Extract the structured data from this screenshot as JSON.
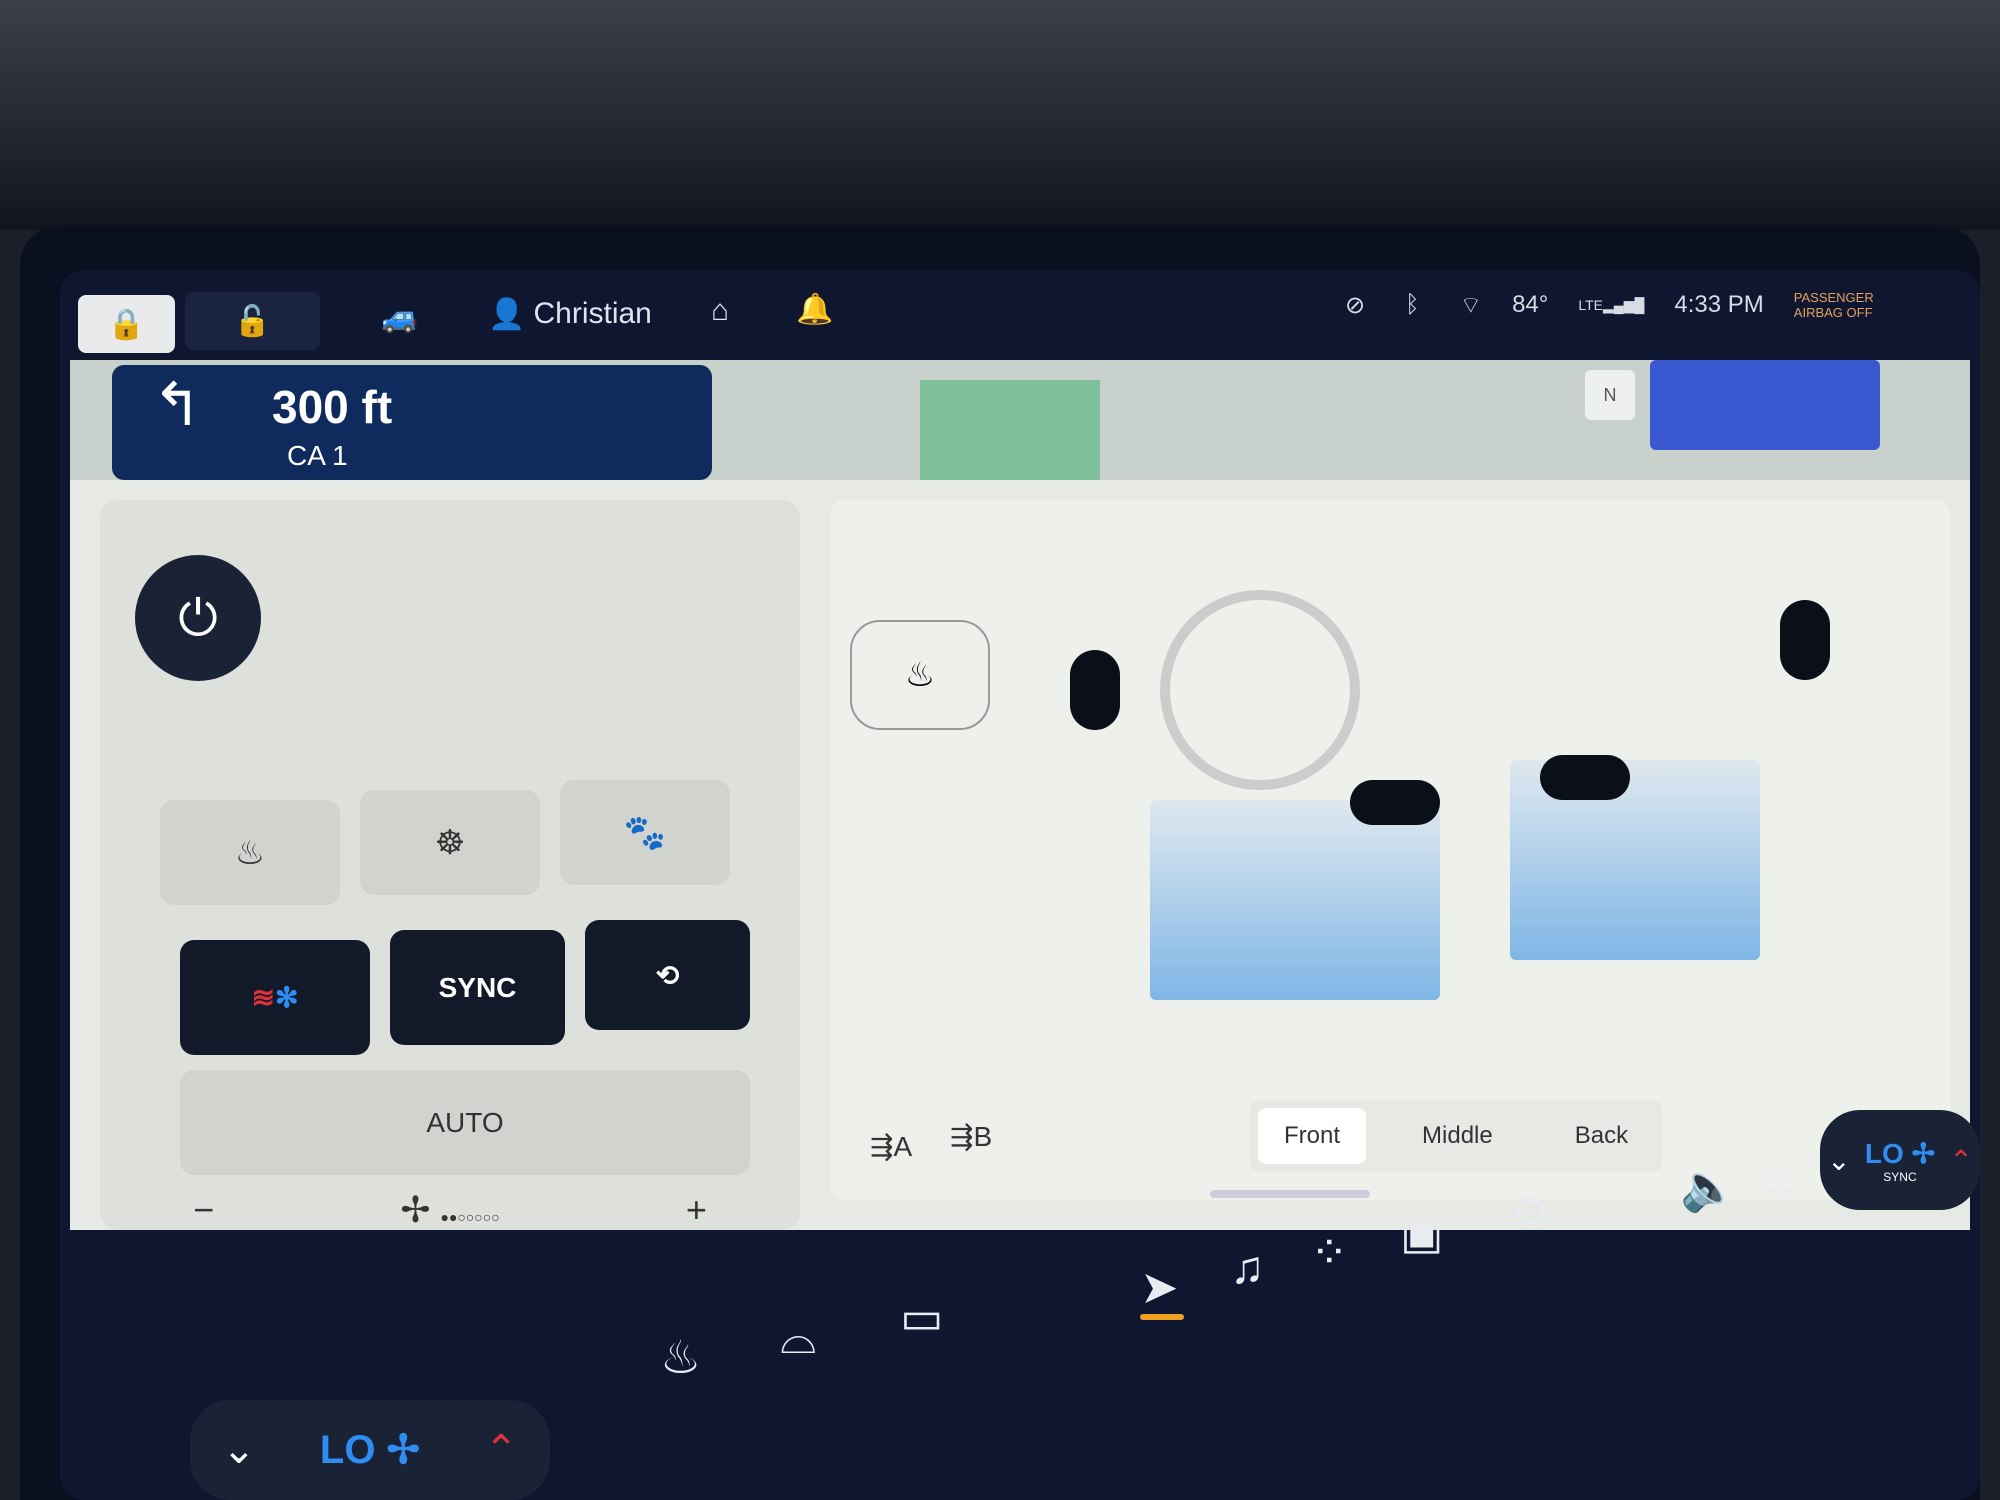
{
  "top_bar": {
    "lock_icon": "lock-closed-icon",
    "unlock_icon": "lock-open-icon",
    "vehicle_icon": "car-icon",
    "profile_name": "Christian",
    "garage_icon": "garage-icon",
    "notification_icon": "bell-icon"
  },
  "status_bar": {
    "temperature": "84°",
    "network": "LTE",
    "time": "4:33 PM",
    "airbag_line1": "PASSENGER",
    "airbag_line2": "AIRBAG OFF",
    "airbag_color": "#e8a060"
  },
  "navigation": {
    "distance": "300 ft",
    "road": "CA 1",
    "compass": "N",
    "turn_icon": "turn-left-arrow-icon"
  },
  "climate": {
    "power_icon": "power-icon",
    "quick_buttons": [
      {
        "name": "mirror-heat",
        "icon": "heated-mirror-icon"
      },
      {
        "name": "steering-heat",
        "icon": "heated-steering-icon"
      },
      {
        "name": "pet-mode",
        "icon": "paw-icon"
      }
    ],
    "mode_buttons": [
      {
        "name": "heat-cool",
        "icon": "heat-cool-icon"
      },
      {
        "name": "sync",
        "label": "SYNC"
      },
      {
        "name": "recirculate",
        "icon": "recirculate-icon"
      }
    ],
    "auto_label": "AUTO",
    "fan_minus": "−",
    "fan_plus": "+",
    "fan_level": 2,
    "fan_levels_total": 7
  },
  "diagram": {
    "zones": [
      "Front",
      "Middle",
      "Back"
    ],
    "active_zone": "Front",
    "vent_a": "A",
    "vent_b": "B",
    "footwell_color": "#7fb6e6"
  },
  "dock": {
    "apps": [
      "navigation-icon",
      "music-icon",
      "apps-icon",
      "camera-icon",
      "settings-icon"
    ],
    "left_temp": "LO",
    "right_temp": "LO",
    "right_sync": "SYNC",
    "accent": "#f0a020",
    "temp_color": "#2f8cf0",
    "up_color": "#e0303a"
  }
}
